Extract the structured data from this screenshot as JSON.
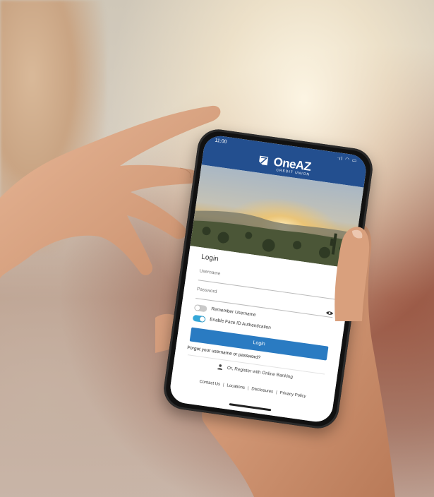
{
  "status_bar": {
    "time": "11:00",
    "icons": "ᐧıl  ◠  ▭"
  },
  "brand": {
    "name": "OneAZ",
    "subtitle": "CREDIT UNION"
  },
  "login": {
    "title": "Login",
    "username_label": "Username",
    "password_label": "Password",
    "remember_label": "Remember Username",
    "remember_enabled": false,
    "faceid_label": "Enable Face ID Authentication",
    "faceid_enabled": true,
    "login_button": "Login",
    "forgot_link": "Forgot your username or password?",
    "register_link": "Or, Register with Online Banking"
  },
  "footer": {
    "contact": "Contact Us",
    "locations": "Locations",
    "disclosures": "Disclosures",
    "privacy": "Privacy Policy",
    "separator": "|"
  },
  "colors": {
    "header": "#234f8f",
    "button": "#2a7bc2",
    "toggle_on": "#35a7d8",
    "toggle_off": "#c9c9c9"
  }
}
